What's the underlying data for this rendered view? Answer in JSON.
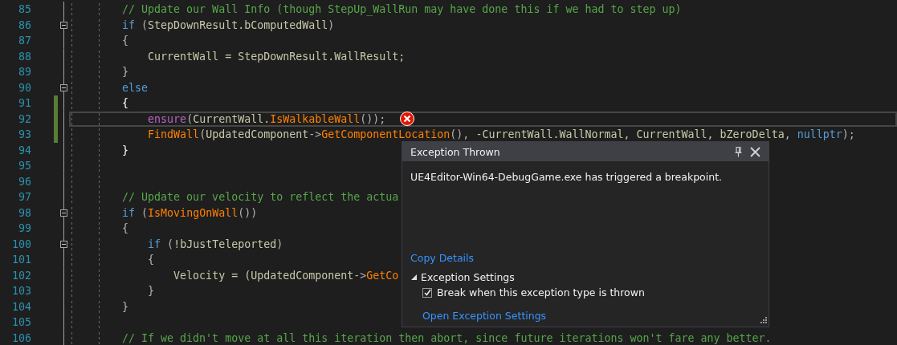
{
  "editor": {
    "lines": [
      {
        "number": "85",
        "foldable": false,
        "changed": false,
        "current": false,
        "error": false,
        "tokens": [
          {
            "kind": "comment",
            "text": "        // Update our Wall Info (though StepUp_WallRun may have done this if we had to step up)"
          }
        ]
      },
      {
        "number": "86",
        "foldable": true,
        "changed": false,
        "current": false,
        "error": false,
        "tokens": [
          {
            "kind": "keyword",
            "text": "        if"
          },
          {
            "kind": "punct",
            "text": " ("
          },
          {
            "kind": "var",
            "text": "StepDownResult.bComputedWall"
          },
          {
            "kind": "punct",
            "text": ")"
          }
        ]
      },
      {
        "number": "87",
        "foldable": false,
        "changed": false,
        "current": false,
        "error": false,
        "tokens": [
          {
            "kind": "punct",
            "text": "        {"
          }
        ]
      },
      {
        "number": "88",
        "foldable": false,
        "changed": false,
        "current": false,
        "error": false,
        "tokens": [
          {
            "kind": "var",
            "text": "            CurrentWall = StepDownResult.WallResult;"
          }
        ]
      },
      {
        "number": "89",
        "foldable": false,
        "changed": false,
        "current": false,
        "error": false,
        "tokens": [
          {
            "kind": "punct",
            "text": "        }"
          }
        ]
      },
      {
        "number": "90",
        "foldable": true,
        "changed": false,
        "current": false,
        "error": false,
        "tokens": [
          {
            "kind": "keyword",
            "text": "        else"
          }
        ]
      },
      {
        "number": "91",
        "foldable": false,
        "changed": true,
        "current": false,
        "error": false,
        "tokens": [
          {
            "kind": "brace",
            "text": "        {"
          }
        ]
      },
      {
        "number": "92",
        "foldable": false,
        "changed": true,
        "current": true,
        "error": true,
        "tokens": [
          {
            "kind": "macro",
            "text": "            ensure"
          },
          {
            "kind": "punct",
            "text": "("
          },
          {
            "kind": "var",
            "text": "CurrentWall."
          },
          {
            "kind": "func",
            "text": "IsWalkableWall"
          },
          {
            "kind": "punct",
            "text": "());"
          }
        ]
      },
      {
        "number": "93",
        "foldable": false,
        "changed": true,
        "current": false,
        "error": false,
        "tokens": [
          {
            "kind": "func",
            "text": "            FindWall"
          },
          {
            "kind": "punct",
            "text": "("
          },
          {
            "kind": "var",
            "text": "UpdatedComponent"
          },
          {
            "kind": "punct",
            "text": "->"
          },
          {
            "kind": "func",
            "text": "GetComponentLocation"
          },
          {
            "kind": "punct",
            "text": "(), "
          },
          {
            "kind": "var",
            "text": "-CurrentWall.WallNormal, CurrentWall, bZeroDelta"
          },
          {
            "kind": "punct",
            "text": ", "
          },
          {
            "kind": "keyword",
            "text": "nullptr"
          },
          {
            "kind": "punct",
            "text": ");"
          }
        ]
      },
      {
        "number": "94",
        "foldable": false,
        "changed": false,
        "current": false,
        "error": false,
        "tokens": [
          {
            "kind": "brace",
            "text": "        }"
          }
        ]
      },
      {
        "number": "95",
        "foldable": false,
        "changed": false,
        "current": false,
        "error": false
      },
      {
        "number": "96",
        "foldable": false,
        "changed": false,
        "current": false,
        "error": false
      },
      {
        "number": "97",
        "foldable": false,
        "changed": false,
        "current": false,
        "error": false,
        "tokens": [
          {
            "kind": "comment",
            "text": "        // Update our velocity to reflect the actua"
          }
        ]
      },
      {
        "number": "98",
        "foldable": true,
        "changed": false,
        "current": false,
        "error": false,
        "tokens": [
          {
            "kind": "keyword",
            "text": "        if"
          },
          {
            "kind": "punct",
            "text": " ("
          },
          {
            "kind": "func",
            "text": "IsMovingOnWall"
          },
          {
            "kind": "punct",
            "text": "())"
          }
        ]
      },
      {
        "number": "99",
        "foldable": false,
        "changed": false,
        "current": false,
        "error": false,
        "tokens": [
          {
            "kind": "punct",
            "text": "        {"
          }
        ]
      },
      {
        "number": "100",
        "foldable": true,
        "changed": false,
        "current": false,
        "error": false,
        "tokens": [
          {
            "kind": "keyword",
            "text": "            if"
          },
          {
            "kind": "punct",
            "text": " ("
          },
          {
            "kind": "var",
            "text": "!bJustTeleported"
          },
          {
            "kind": "punct",
            "text": ")"
          }
        ]
      },
      {
        "number": "101",
        "foldable": false,
        "changed": false,
        "current": false,
        "error": false,
        "tokens": [
          {
            "kind": "punct",
            "text": "            {"
          }
        ]
      },
      {
        "number": "102",
        "foldable": false,
        "changed": false,
        "current": false,
        "error": false,
        "tokens": [
          {
            "kind": "var",
            "text": "                Velocity = (UpdatedComponent"
          },
          {
            "kind": "punct",
            "text": "->"
          },
          {
            "kind": "func",
            "text": "GetCo"
          }
        ]
      },
      {
        "number": "103",
        "foldable": false,
        "changed": false,
        "current": false,
        "error": false,
        "tokens": [
          {
            "kind": "punct",
            "text": "            }"
          }
        ]
      },
      {
        "number": "104",
        "foldable": false,
        "changed": false,
        "current": false,
        "error": false,
        "tokens": [
          {
            "kind": "punct",
            "text": "        }"
          }
        ]
      },
      {
        "number": "105",
        "foldable": false,
        "changed": false,
        "current": false,
        "error": false
      },
      {
        "number": "106",
        "foldable": false,
        "changed": false,
        "current": false,
        "error": false,
        "tokens": [
          {
            "kind": "comment",
            "text": "        // If we didn't move at all this iteration then abort, since future iterations won't fare any better."
          }
        ]
      }
    ]
  },
  "exception_popup": {
    "title": "Exception Thrown",
    "message": "UE4Editor-Win64-DebugGame.exe has triggered a breakpoint.",
    "link": "Copy Details",
    "settings": {
      "label": "Exception Settings",
      "expanded": true,
      "option": {
        "label": "Break when this exception type is thrown",
        "checked": true
      },
      "link": "Open Exception Settings"
    }
  }
}
